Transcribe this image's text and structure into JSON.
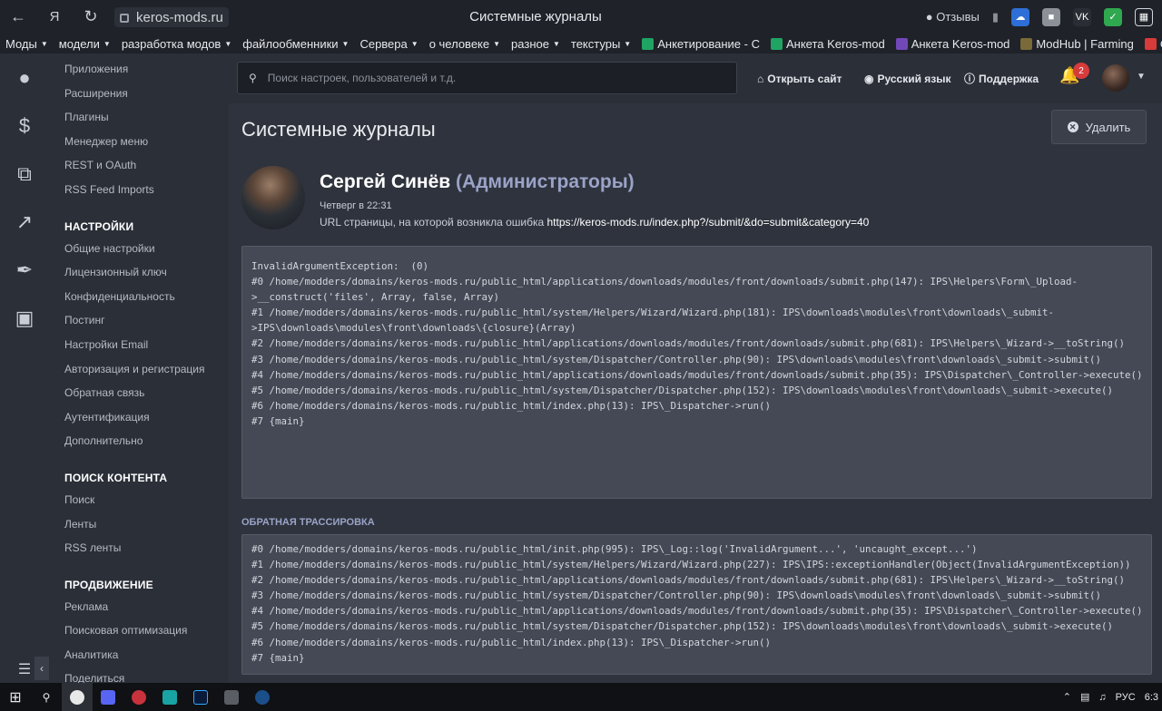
{
  "browser": {
    "url": "keros-mods.ru",
    "tab_title": "Системные журналы",
    "reviews_label": "Отзывы"
  },
  "bookmarks": [
    {
      "label": "Моды",
      "caret": true
    },
    {
      "label": "модели",
      "caret": true
    },
    {
      "label": "разработка модов",
      "caret": true
    },
    {
      "label": "файлообменники",
      "caret": true
    },
    {
      "label": "Сервера",
      "caret": true
    },
    {
      "label": "о человеке",
      "caret": true
    },
    {
      "label": "разное",
      "caret": true
    },
    {
      "label": "текстуры",
      "caret": true
    },
    {
      "label": "Анкетирование - С",
      "icon_color": "#1fa463"
    },
    {
      "label": "Анкета Keros-mod",
      "icon_color": "#1fa463"
    },
    {
      "label": "Анкета Keros-mod",
      "icon_color": "#7248b9"
    },
    {
      "label": "ModHub | Farming",
      "icon_color": "#7a6a3a"
    },
    {
      "label": "Список",
      "icon_color": "#d93a3a"
    }
  ],
  "rail_icons": [
    "user-icon",
    "dollar-icon",
    "copy-icon",
    "chart-icon",
    "brush-icon",
    "basket-icon"
  ],
  "sidebar": {
    "top_items": [
      "Приложения",
      "Расширения",
      "Плагины",
      "Менеджер меню",
      "REST и OAuth",
      "RSS Feed Imports"
    ],
    "sections": [
      {
        "title": "НАСТРОЙКИ",
        "items": [
          "Общие настройки",
          "Лицензионный ключ",
          "Конфиденциальность",
          "Постинг",
          "Настройки Email",
          "Авторизация и регистрация",
          "Обратная связь",
          "Аутентификация",
          "Дополнительно"
        ]
      },
      {
        "title": "ПОИСК КОНТЕНТА",
        "items": [
          "Поиск",
          "Ленты",
          "RSS ленты"
        ]
      },
      {
        "title": "ПРОДВИЖЕНИЕ",
        "items": [
          "Реклама",
          "Поисковая оптимизация",
          "Аналитика",
          "Поделиться"
        ]
      }
    ]
  },
  "topbar": {
    "search_placeholder": "Поиск настроек, пользователей и т.д.",
    "open_site": "Открыть сайт",
    "language": "Русский язык",
    "support": "Поддержка",
    "notification_count": "2"
  },
  "main": {
    "title": "Системные журналы",
    "delete_label": "Удалить",
    "author": {
      "name": "Сергей Синёв",
      "group": "(Администраторы)",
      "time": "Четверг в 22:31",
      "url_label": "URL страницы, на которой возникла ошибка",
      "url": "https://keros-mods.ru/index.php?/submit/&do=submit&category=40"
    },
    "log_text": "InvalidArgumentException:  (0)\n#0 /home/modders/domains/keros-mods.ru/public_html/applications/downloads/modules/front/downloads/submit.php(147): IPS\\Helpers\\Form\\_Upload-\n>__construct('files', Array, false, Array)\n#1 /home/modders/domains/keros-mods.ru/public_html/system/Helpers/Wizard/Wizard.php(181): IPS\\downloads\\modules\\front\\downloads\\_submit-\n>IPS\\downloads\\modules\\front\\downloads\\{closure}(Array)\n#2 /home/modders/domains/keros-mods.ru/public_html/applications/downloads/modules/front/downloads/submit.php(681): IPS\\Helpers\\_Wizard->__toString()\n#3 /home/modders/domains/keros-mods.ru/public_html/system/Dispatcher/Controller.php(90): IPS\\downloads\\modules\\front\\downloads\\_submit->submit()\n#4 /home/modders/domains/keros-mods.ru/public_html/applications/downloads/modules/front/downloads/submit.php(35): IPS\\Dispatcher\\_Controller->execute()\n#5 /home/modders/domains/keros-mods.ru/public_html/system/Dispatcher/Dispatcher.php(152): IPS\\downloads\\modules\\front\\downloads\\_submit->execute()\n#6 /home/modders/domains/keros-mods.ru/public_html/index.php(13): IPS\\_Dispatcher->run()\n#7 {main}",
    "trace_label": "ОБРАТНАЯ ТРАССИРОВКА",
    "trace_text": "#0 /home/modders/domains/keros-mods.ru/public_html/init.php(995): IPS\\_Log::log('InvalidArgument...', 'uncaught_except...')\n#1 /home/modders/domains/keros-mods.ru/public_html/system/Helpers/Wizard/Wizard.php(227): IPS\\IPS::exceptionHandler(Object(InvalidArgumentException))\n#2 /home/modders/domains/keros-mods.ru/public_html/applications/downloads/modules/front/downloads/submit.php(681): IPS\\Helpers\\_Wizard->__toString()\n#3 /home/modders/domains/keros-mods.ru/public_html/system/Dispatcher/Controller.php(90): IPS\\downloads\\modules\\front\\downloads\\_submit->submit()\n#4 /home/modders/domains/keros-mods.ru/public_html/applications/downloads/modules/front/downloads/submit.php(35): IPS\\Dispatcher\\_Controller->execute()\n#5 /home/modders/domains/keros-mods.ru/public_html/system/Dispatcher/Dispatcher.php(152): IPS\\downloads\\modules\\front\\downloads\\_submit->execute()\n#6 /home/modders/domains/keros-mods.ru/public_html/index.php(13): IPS\\_Dispatcher->run()\n#7 {main}"
  },
  "taskbar": {
    "language": "РУС",
    "clock": "6:3"
  }
}
